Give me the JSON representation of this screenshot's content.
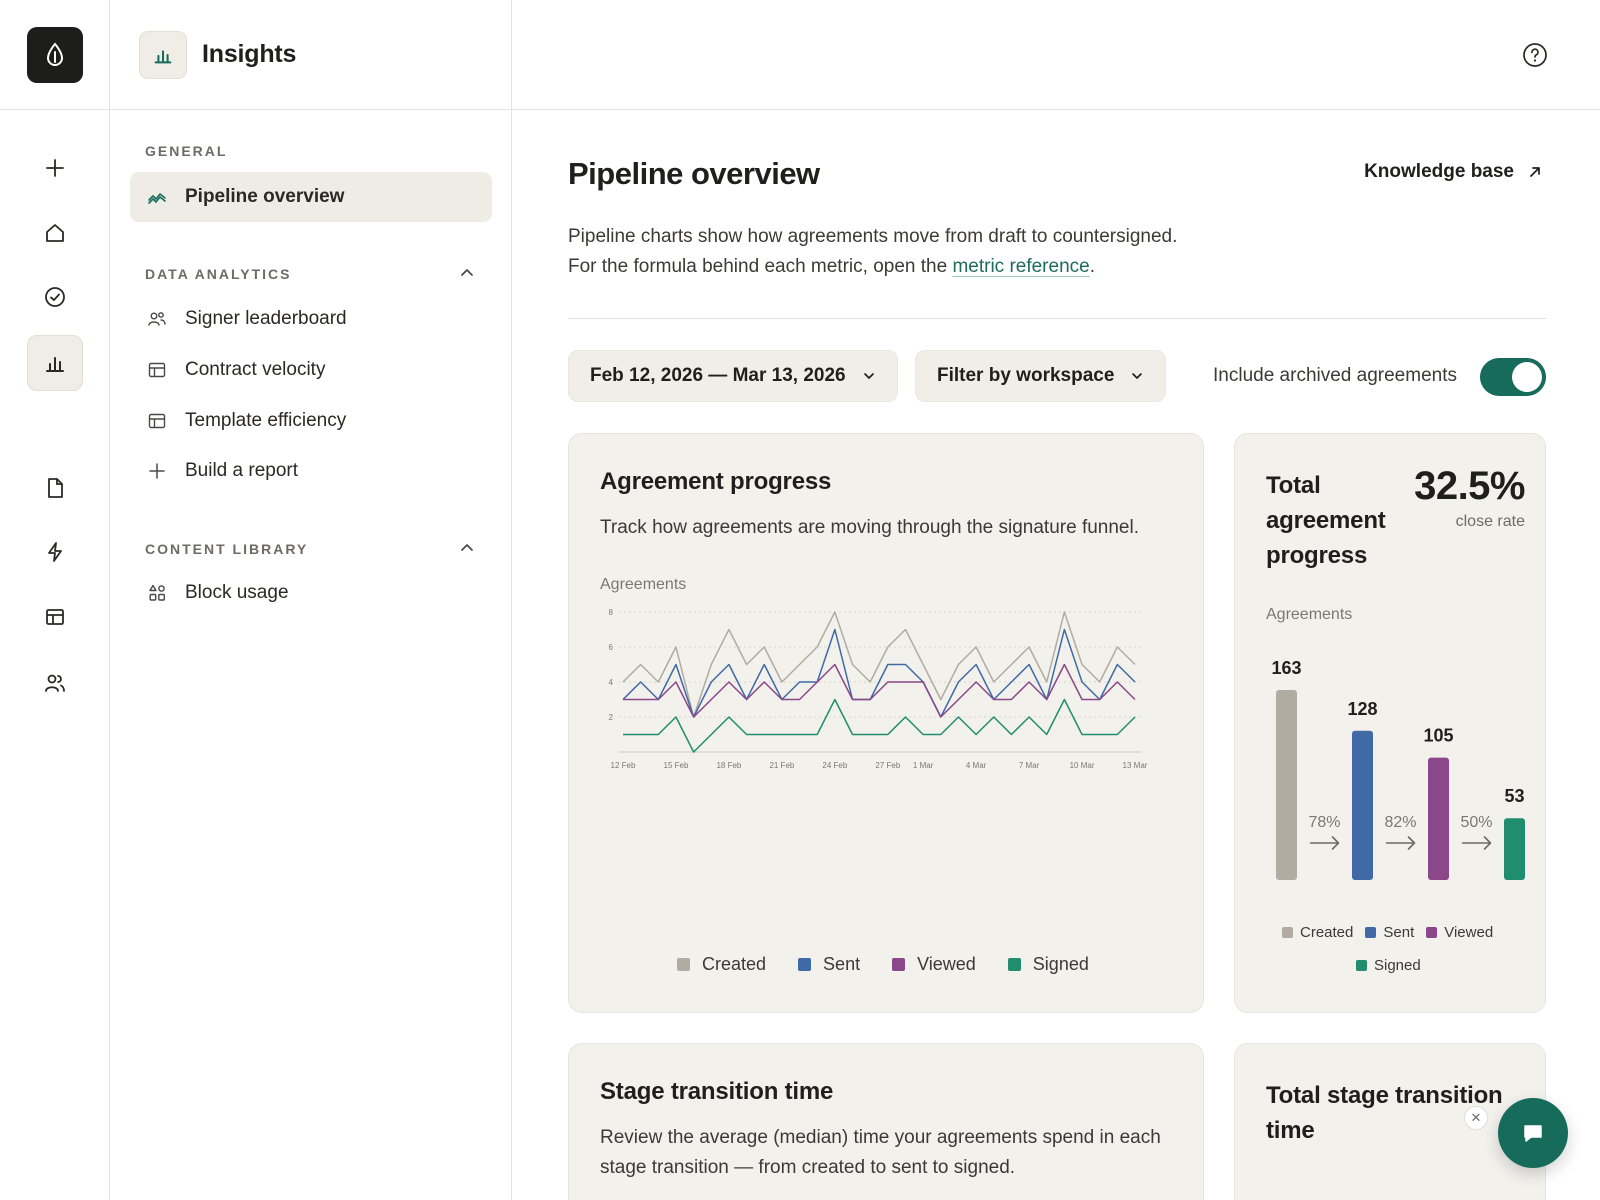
{
  "sidebar": {
    "title": "Insights",
    "sections": {
      "general": "GENERAL",
      "analytics": "DATA ANALYTICS",
      "library": "CONTENT LIBRARY"
    },
    "items": {
      "pipeline": "Pipeline overview",
      "leaderboard": "Signer leaderboard",
      "velocity": "Contract velocity",
      "template": "Template efficiency",
      "report": "Build a report",
      "blocks": "Block usage"
    }
  },
  "main": {
    "title": "Pipeline overview",
    "kb_label": "Knowledge base",
    "desc_line1": "Pipeline charts show how agreements move from draft to countersigned.",
    "desc_line2_pre": "For the formula behind each metric, open the ",
    "desc_link": "metric reference",
    "desc_line2_post": ".",
    "date_range": "Feb 12, 2026 — Mar 13, 2026",
    "workspace_filter": "Filter by workspace",
    "archived_label": "Include archived agreements",
    "archived_on": true
  },
  "colors": {
    "created": "#b1aca1",
    "sent": "#3f6aa6",
    "viewed": "#8a4789",
    "signed": "#1f8d6e",
    "accent": "#166b5a"
  },
  "cards": {
    "progress_title": "Agreement progress",
    "progress_sub": "Track how agreements are moving through the signature funnel.",
    "progress_axis": "Agreements",
    "total_title_1": "Total",
    "total_title_2": "agreement",
    "total_title_3": "progress",
    "total_stat": "32.5%",
    "total_stat_caption": "close rate",
    "total_axis": "Agreements",
    "stage_title": "Stage transition time",
    "stage_sub_1": "Review the average (median) time your agreements spend in each",
    "stage_sub_2": "stage transition — from created to sent to signed.",
    "stage_total_title_1": "Total stage transition",
    "stage_total_title_2": "time"
  },
  "chart_data": [
    {
      "type": "line",
      "title": "Agreement progress",
      "ylabel": "Agreements",
      "ylim": [
        0,
        8
      ],
      "yticks": [
        2,
        4,
        6,
        8
      ],
      "xticks": [
        "12 Feb",
        "15 Feb",
        "18 Feb",
        "21 Feb",
        "24 Feb",
        "27 Feb",
        "1 Mar",
        "4 Mar",
        "7 Mar",
        "10 Mar",
        "13 Mar"
      ],
      "x": [
        "12 Feb",
        "13 Feb",
        "14 Feb",
        "15 Feb",
        "16 Feb",
        "17 Feb",
        "18 Feb",
        "19 Feb",
        "20 Feb",
        "21 Feb",
        "22 Feb",
        "23 Feb",
        "24 Feb",
        "25 Feb",
        "26 Feb",
        "27 Feb",
        "28 Feb",
        "1 Mar",
        "2 Mar",
        "3 Mar",
        "4 Mar",
        "5 Mar",
        "6 Mar",
        "7 Mar",
        "8 Mar",
        "9 Mar",
        "10 Mar",
        "11 Mar",
        "12 Mar",
        "13 Mar"
      ],
      "grid": true,
      "legend": "bottom",
      "series": [
        {
          "name": "Created",
          "color": "#b1aca1",
          "values": [
            4,
            5,
            4,
            6,
            2,
            5,
            7,
            5,
            6,
            4,
            5,
            6,
            8,
            5,
            4,
            6,
            7,
            5,
            3,
            5,
            6,
            4,
            5,
            6,
            4,
            8,
            5,
            4,
            6,
            5
          ]
        },
        {
          "name": "Sent",
          "color": "#3f6aa6",
          "values": [
            3,
            4,
            3,
            5,
            2,
            4,
            5,
            3,
            5,
            3,
            4,
            4,
            7,
            3,
            3,
            5,
            5,
            4,
            2,
            4,
            5,
            3,
            4,
            5,
            3,
            7,
            4,
            3,
            5,
            4
          ]
        },
        {
          "name": "Viewed",
          "color": "#8a4789",
          "values": [
            3,
            3,
            3,
            4,
            2,
            3,
            4,
            3,
            4,
            3,
            3,
            4,
            5,
            3,
            3,
            4,
            4,
            4,
            2,
            3,
            4,
            3,
            3,
            4,
            3,
            5,
            3,
            3,
            4,
            3
          ]
        },
        {
          "name": "Signed",
          "color": "#1f8d6e",
          "values": [
            1,
            1,
            1,
            2,
            0,
            1,
            2,
            1,
            1,
            1,
            1,
            1,
            3,
            1,
            1,
            1,
            2,
            1,
            1,
            2,
            1,
            2,
            1,
            2,
            1,
            3,
            1,
            1,
            1,
            2
          ]
        }
      ]
    },
    {
      "type": "bar",
      "title": "Total agreement progress",
      "ylabel": "Agreements",
      "categories": [
        "Created",
        "Sent",
        "Viewed",
        "Signed"
      ],
      "values": [
        163,
        128,
        105,
        53
      ],
      "colors": [
        "#b1aca1",
        "#3f6aa6",
        "#8a4789",
        "#1f8d6e"
      ],
      "conversions": [
        "78%",
        "82%",
        "50%"
      ],
      "legend": "bottom"
    }
  ]
}
